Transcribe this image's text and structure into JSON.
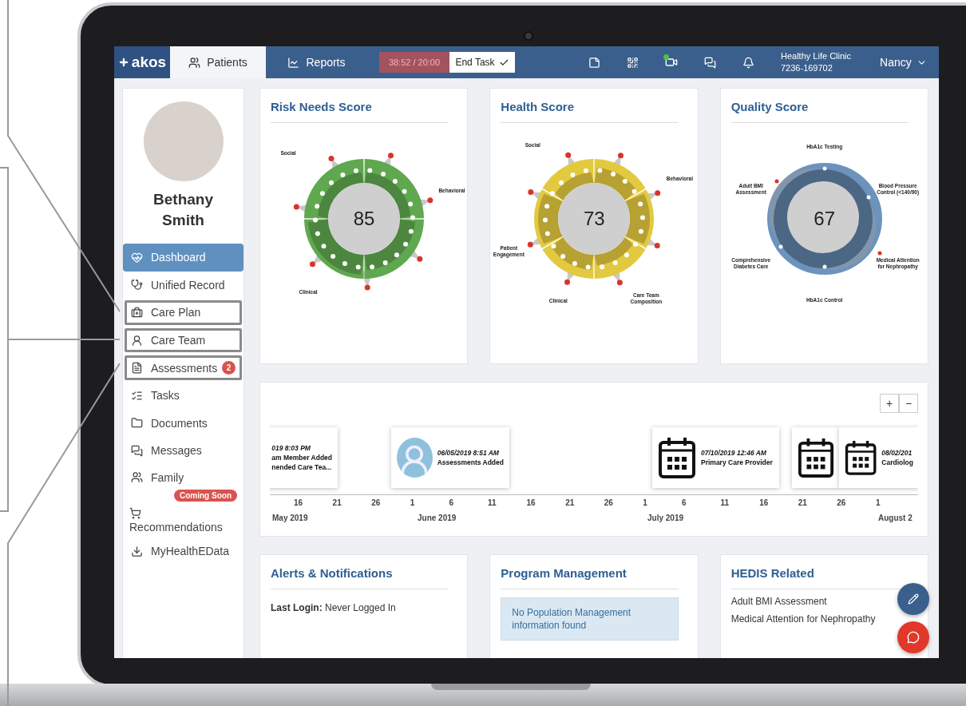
{
  "nav": {
    "logo": "akos",
    "tabs": [
      {
        "label": "Patients",
        "selected": true
      },
      {
        "label": "Reports",
        "selected": false
      }
    ],
    "timer": "38:52 / 20:00",
    "end_task": "End Task",
    "video_online": true,
    "clinic": {
      "name": "Healthy Life Clinic",
      "phone": "7236-169702"
    },
    "user": "Nancy"
  },
  "patient": {
    "name": "Bethany Smith"
  },
  "sidebar": {
    "items": [
      {
        "label": "Dashboard",
        "selected": true,
        "highlighted": false,
        "kind": "inline"
      },
      {
        "label": "Unified Record",
        "selected": false,
        "highlighted": false,
        "kind": "inline"
      },
      {
        "label": "Care Plan",
        "selected": false,
        "highlighted": true,
        "kind": "inline"
      },
      {
        "label": "Care Team",
        "selected": false,
        "highlighted": true,
        "kind": "inline"
      },
      {
        "label": "Assessments",
        "selected": false,
        "highlighted": true,
        "kind": "inline",
        "badge": "2"
      },
      {
        "label": "Tasks",
        "selected": false,
        "highlighted": false,
        "kind": "inline"
      },
      {
        "label": "Documents",
        "selected": false,
        "highlighted": false,
        "kind": "inline"
      },
      {
        "label": "Messages",
        "selected": false,
        "highlighted": false,
        "kind": "inline"
      },
      {
        "label": "Family",
        "selected": false,
        "highlighted": false,
        "kind": "inline",
        "tag": "Coming Soon"
      },
      {
        "label": "Recommendations",
        "selected": false,
        "highlighted": false,
        "kind": "stacked"
      },
      {
        "label": "MyHealthEData",
        "selected": false,
        "highlighted": false,
        "kind": "inline"
      }
    ]
  },
  "score_cards": [
    {
      "title": "Risk Needs Score",
      "score": "85",
      "kind": "petal",
      "color": "#5fa84f",
      "labels": [
        "Social",
        "Behavioral",
        "Clinical"
      ]
    },
    {
      "title": "Health Score",
      "score": "73",
      "kind": "petal",
      "color": "#e3c93f",
      "labels": [
        "Social",
        "Behavioral",
        "Patient\nEngagement",
        "Clinical",
        "Care Team\nComposition"
      ]
    },
    {
      "title": "Quality Score",
      "score": "67",
      "kind": "blob",
      "color": "#6b93bd",
      "labels": [
        "HbA1c Testing",
        "Adult BMI\nAssessment",
        "Blood Pressure\nControl (<140/90)",
        "Comprehensive\nDiabetes Care",
        "Medical Attention\nfor Nephropathy",
        "HbA1c Control"
      ]
    }
  ],
  "timeline": {
    "zoom_in": "+",
    "zoom_out": "−",
    "events": [
      {
        "kind": "clipped",
        "date": "019 8:03 PM",
        "title": "am Member Added",
        "subtitle": "nended Care Tea..."
      },
      {
        "kind": "avatar",
        "date": "06/05/2019 8:51 AM",
        "title": "Assessments Added"
      },
      {
        "kind": "calendar",
        "date": "07/10/2019 12:46 AM",
        "title": "Primary Care Provider"
      },
      {
        "kind": "calendar"
      },
      {
        "kind": "calendar",
        "date": "08/02/201",
        "title": "Cardiolog"
      }
    ],
    "ticks": [
      "16",
      "21",
      "26",
      "1",
      "6",
      "11",
      "16",
      "21",
      "26",
      "1",
      "6",
      "11",
      "16",
      "21",
      "26",
      "1"
    ],
    "months": [
      "May 2019",
      "June 2019",
      "July 2019",
      "August 2"
    ]
  },
  "alerts": {
    "title": "Alerts & Notifications",
    "text": "**Last Login:** Never Logged In"
  },
  "program": {
    "title": "Program Management",
    "notice": "No Population Management information found"
  },
  "hedis": {
    "title": "HEDIS Related",
    "items": [
      "Adult BMI Assessment",
      "Medical Attention for Nephropathy"
    ]
  }
}
